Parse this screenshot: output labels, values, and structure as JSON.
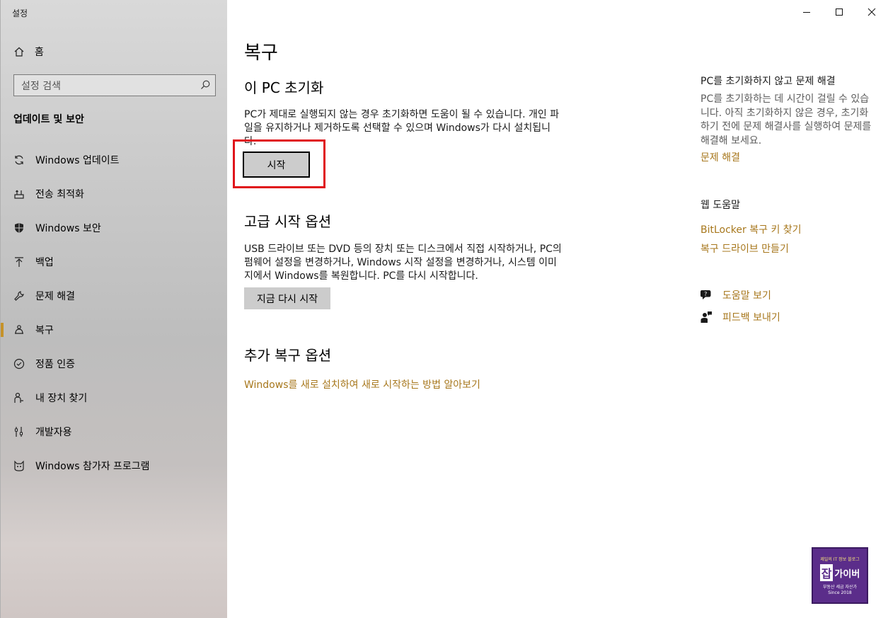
{
  "window": {
    "title": "설정",
    "controls": [
      "minimize",
      "maximize",
      "close"
    ]
  },
  "sidebar": {
    "home_label": "홈",
    "search_placeholder": "설정 검색",
    "section_title": "업데이트 및 보안",
    "items": [
      {
        "label": "Windows 업데이트",
        "icon": "sync-icon"
      },
      {
        "label": "전송 최적화",
        "icon": "delivery-icon"
      },
      {
        "label": "Windows 보안",
        "icon": "shield-icon"
      },
      {
        "label": "백업",
        "icon": "upload-arrow-icon"
      },
      {
        "label": "문제 해결",
        "icon": "wrench-icon"
      },
      {
        "label": "복구",
        "icon": "recovery-icon",
        "active": true
      },
      {
        "label": "정품 인증",
        "icon": "check-circle-icon"
      },
      {
        "label": "내 장치 찾기",
        "icon": "person-locate-icon"
      },
      {
        "label": "개발자용",
        "icon": "developer-icon"
      },
      {
        "label": "Windows 참가자 프로그램",
        "icon": "insider-icon"
      }
    ]
  },
  "main": {
    "page_title": "복구",
    "reset": {
      "heading": "이 PC 초기화",
      "description": "PC가 제대로 실행되지 않는 경우 초기화하면 도움이 될 수 있습니다. 개인 파일을 유지하거나 제거하도록 선택할 수 있으며 Windows가 다시 설치됩니다.",
      "button_label": "시작"
    },
    "advanced": {
      "heading": "고급 시작 옵션",
      "description": "USB 드라이브 또는 DVD 등의 장치 또는 디스크에서 직접 시작하거나, PC의 펌웨어 설정을 변경하거나, Windows 시작 설정을 변경하거나, 시스템 이미지에서 Windows를 복원합니다. PC를 다시 시작합니다.",
      "button_label": "지금 다시 시작"
    },
    "more": {
      "heading": "추가 복구 옵션",
      "link": "Windows를 새로 설치하여 새로 시작하는 방법 알아보기"
    }
  },
  "right": {
    "troubleshoot_title": "PC를 초기화하지 않고 문제 해결",
    "troubleshoot_text": "PC를 초기화하는 데 시간이 걸릴 수 있습니다. 아직 초기화하지 않은 경우, 초기화하기 전에 문제 해결사를 실행하여 문제를 해결해 보세요.",
    "troubleshoot_link": "문제 해결",
    "web_help_title": "웹 도움말",
    "web_links": [
      "BitLocker 복구 키 찾기",
      "복구 드라이브 만들기"
    ],
    "get_help": "도움말 보기",
    "feedback": "피드백 보내기"
  },
  "watermark": {
    "top": "제일의 IT 정보 블로그",
    "big": "잡",
    "brand": "가이버",
    "sub": "부동산 세금 자산가",
    "since": "Since 2018"
  },
  "colors": {
    "accent_link": "#a7771c",
    "active_indicator": "#c69229",
    "highlight_box": "#e0151b",
    "button_bg": "#cccccc"
  }
}
